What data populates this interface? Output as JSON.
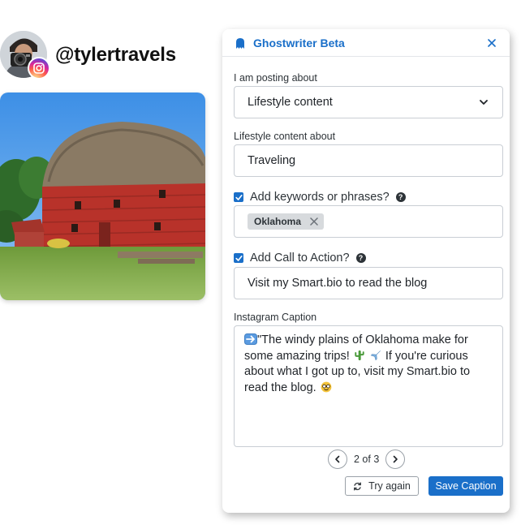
{
  "profile": {
    "handle": "@tylertravels",
    "badge_icon": "instagram-icon"
  },
  "panel": {
    "title": "Ghostwriter Beta",
    "accent_color": "#1a6fc9",
    "topic": {
      "label": "I am posting about",
      "selected": "Lifestyle content"
    },
    "subject": {
      "label": "Lifestyle content about",
      "value": "Traveling"
    },
    "keywords": {
      "label": "Add keywords or phrases?",
      "checked": true,
      "tags": [
        "Oklahoma"
      ]
    },
    "cta": {
      "label": "Add Call to Action?",
      "checked": true,
      "value": "Visit my Smart.bio to read the blog"
    },
    "caption": {
      "label": "Instagram Caption",
      "part1": "\"The windy plains of Oklahoma make for some amazing trips! ",
      "part2": " If you're curious about what I got up to, visit my Smart.bio to read the blog. "
    },
    "pager": {
      "text": "2 of 3",
      "current": 2,
      "total": 3
    },
    "buttons": {
      "try_again": "Try again",
      "save": "Save Caption"
    }
  }
}
